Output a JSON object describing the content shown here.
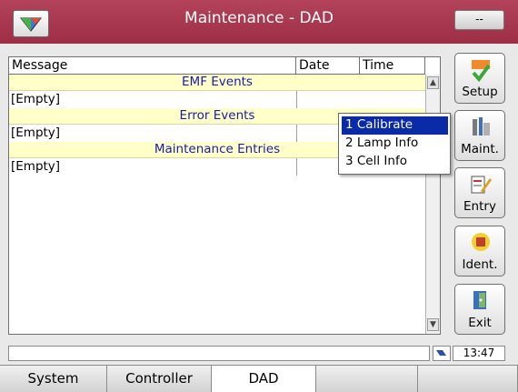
{
  "window": {
    "title": "Maintenance - DAD",
    "corner_button": "--"
  },
  "table": {
    "columns": [
      "Message",
      "Date",
      "Time"
    ],
    "sections": [
      {
        "title": "EMF Events",
        "value": "[Empty]"
      },
      {
        "title": "Error Events",
        "value": "[Empty]"
      },
      {
        "title": "Maintenance Entries",
        "value": "[Empty]"
      }
    ]
  },
  "popup": {
    "items": [
      "1 Calibrate",
      "2 Lamp Info",
      "3 Cell Info"
    ],
    "selected": "1 Calibrate"
  },
  "side_buttons": {
    "setup": "Setup",
    "maint": "Maint.",
    "entry": "Entry",
    "ident": "Ident.",
    "exit": "Exit"
  },
  "status": {
    "message": "",
    "time": "13:47"
  },
  "tabs": [
    "System",
    "Controller",
    "DAD",
    "",
    ""
  ],
  "active_tab": "DAD",
  "colors": {
    "title_bar": "#a93a52",
    "section_bg": "#ffffc8",
    "section_text": "#1a1ab0",
    "menu_selected": "#0b2aa8"
  }
}
